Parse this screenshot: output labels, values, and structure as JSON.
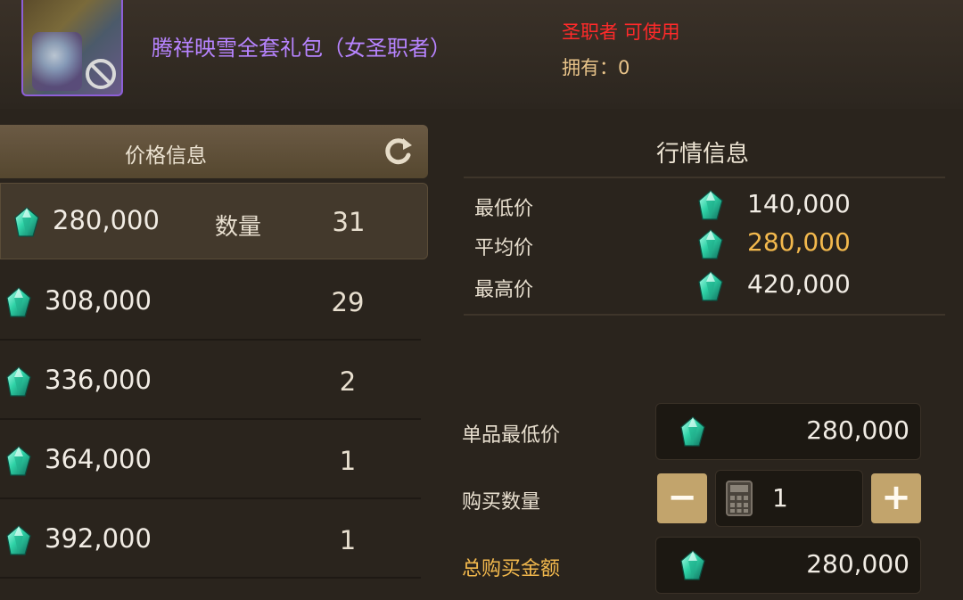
{
  "item": {
    "name": "腾祥映雪全套礼包（女圣职者）",
    "class_requirement": "圣职者 可使用",
    "owned_label": "拥有：",
    "owned_value": "0"
  },
  "price_panel": {
    "title": "价格信息",
    "quantity_label": "数量",
    "rows": [
      {
        "price": "280,000",
        "qty": "31"
      },
      {
        "price": "308,000",
        "qty": "29"
      },
      {
        "price": "336,000",
        "qty": "2"
      },
      {
        "price": "364,000",
        "qty": "1"
      },
      {
        "price": "392,000",
        "qty": "1"
      }
    ]
  },
  "market": {
    "title": "行情信息",
    "lowest_label": "最低价",
    "lowest_value": "140,000",
    "average_label": "平均价",
    "average_value": "280,000",
    "highest_label": "最高价",
    "highest_value": "420,000"
  },
  "purchase": {
    "unit_min_label": "单品最低价",
    "unit_min_value": "280,000",
    "quantity_label": "购买数量",
    "quantity_value": "1",
    "minus": "−",
    "plus": "+",
    "total_label": "总购买金额",
    "total_value": "280,000"
  },
  "colors": {
    "item_name": "#b784ff",
    "class_req": "#ff2a2a",
    "highlight": "#f3b94d",
    "gem": "#2fd3a7"
  },
  "icons": [
    "ban-icon",
    "refresh-icon",
    "gem-icon",
    "calculator-icon"
  ]
}
